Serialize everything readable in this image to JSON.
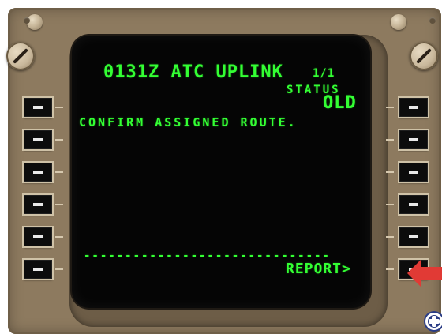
{
  "cdu": {
    "title": "0131z ATC UPLINK",
    "page": "1/1",
    "status_label": "STATUS",
    "status_value": "OLD",
    "message": "CONFIRM ASSIGNED ROUTE.",
    "separator": "------------------------------",
    "report_prompt": "REPORT>"
  },
  "ui": {
    "accent_green": "#33ff33",
    "arrow_color": "#e13a35",
    "line_select_keys": [
      "L1",
      "L2",
      "L3",
      "L4",
      "L5",
      "L6",
      "R1",
      "R2",
      "R3",
      "R4",
      "R5",
      "R6"
    ],
    "icons": [
      "screw-icon",
      "screw-icon",
      "screw-icon",
      "screw-icon",
      "arrow-icon",
      "zoom-icon"
    ]
  }
}
